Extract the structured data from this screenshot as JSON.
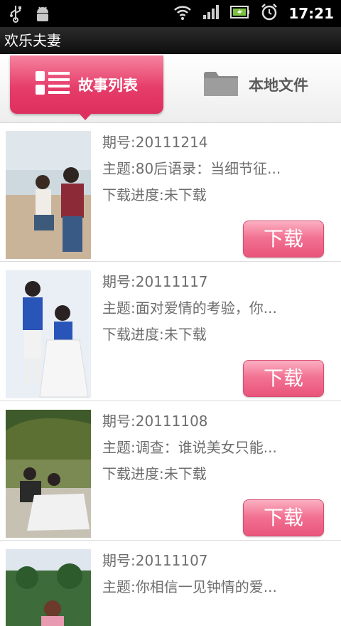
{
  "status_bar": {
    "time": "17:21",
    "left_icons": [
      "usb-icon",
      "android-debug-icon"
    ],
    "right_icons": [
      "wifi-icon",
      "signal-icon",
      "battery-icon",
      "alarm-icon"
    ]
  },
  "app": {
    "title": "欢乐夫妻"
  },
  "tabs": [
    {
      "label": "故事列表",
      "icon": "list-icon",
      "active": true
    },
    {
      "label": "本地文件",
      "icon": "folder-icon",
      "active": false
    }
  ],
  "colors": {
    "accent": "#e63d6a",
    "button": "#f27393",
    "text": "#6e6e6e"
  },
  "items": [
    {
      "issue": "期号:20111214",
      "topic": "主题:80后语录：当细节征...",
      "progress": "下载进度:未下载",
      "button": "下载"
    },
    {
      "issue": "期号:20111117",
      "topic": "主题:面对爱情的考验，你...",
      "progress": "下载进度:未下载",
      "button": "下载"
    },
    {
      "issue": "期号:20111108",
      "topic": "主题:调查：谁说美女只能...",
      "progress": "下载进度:未下载",
      "button": "下载"
    },
    {
      "issue": "期号:20111107",
      "topic": "主题:你相信一见钟情的爱...",
      "progress": "",
      "button": ""
    }
  ]
}
